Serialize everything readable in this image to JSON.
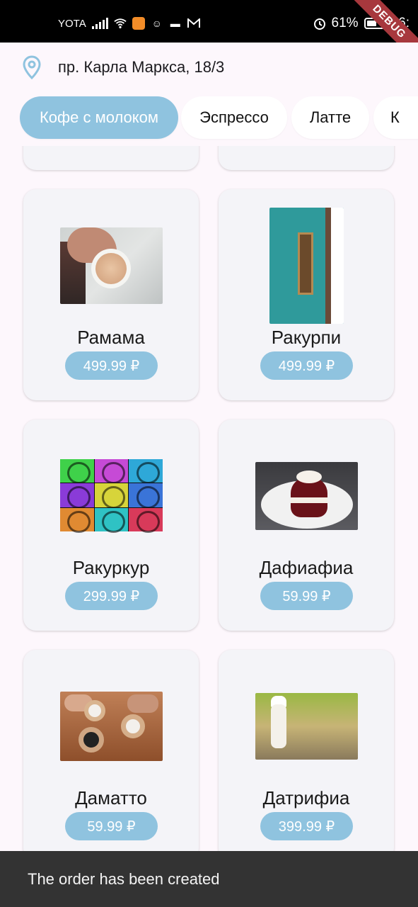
{
  "status_bar": {
    "carrier": "YOTA",
    "battery_percent_text": "61%",
    "battery_level": 0.61,
    "time": "16:",
    "debug_label": "DEBUG",
    "icons": [
      "signal-icon",
      "wifi-icon",
      "app-orange-icon",
      "app-face-icon",
      "car-icon",
      "mail-icon",
      "alarm-icon",
      "battery-icon"
    ]
  },
  "address": {
    "icon": "location-pin-icon",
    "text": "пр. Карла Маркса, 18/3",
    "accent": "#8fc3df"
  },
  "categories": {
    "active_color": "#8fc3df",
    "items": [
      {
        "label": "Кофе с молоком",
        "active": true
      },
      {
        "label": "Эспрессо",
        "active": false
      },
      {
        "label": "Латте",
        "active": false
      },
      {
        "label": "К",
        "active": false
      }
    ]
  },
  "products": [
    {
      "name": "Рамама",
      "price": "499.99 ₽",
      "image": "latte-cup-photo"
    },
    {
      "name": "Ракурпи",
      "price": "499.99 ₽",
      "image": "coffee-wall-sign-photo"
    },
    {
      "name": "Ракуркур",
      "price": "299.99 ₽",
      "image": "pop-art-grid-photo"
    },
    {
      "name": "Дафиафиа",
      "price": "59.99 ₽",
      "image": "red-velvet-cake-photo"
    },
    {
      "name": "Даматто",
      "price": "59.99 ₽",
      "image": "coffee-cups-table-photo"
    },
    {
      "name": "Датрифиа",
      "price": "399.99 ₽",
      "image": "chef-figurine-photo"
    }
  ],
  "snackbar": {
    "message": "The order has been created"
  }
}
